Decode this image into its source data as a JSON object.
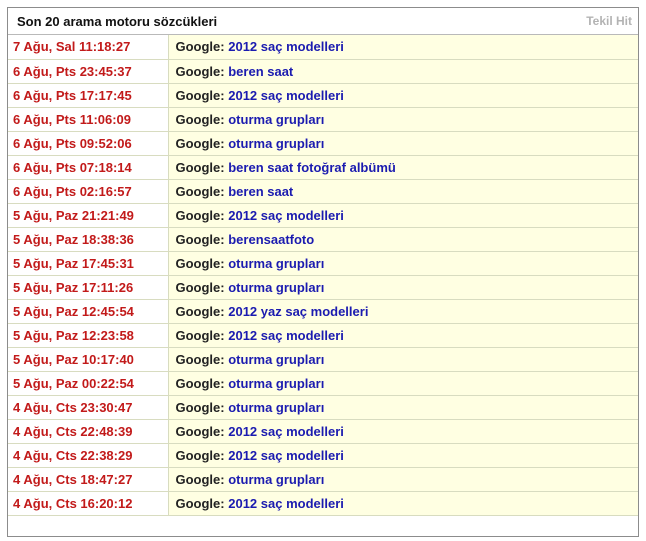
{
  "panel": {
    "title": "Son 20 arama motoru sözcükleri",
    "toggle_label": "Tekil Hit"
  },
  "colors": {
    "time_text": "#c21a1a",
    "keyword_text": "#1b1bb0",
    "row_background": "#ffffe2",
    "header_link": "#b3b3b3"
  },
  "rows": [
    {
      "time": "7 Ağu, Sal 11:18:27",
      "engine": "Google:",
      "keyword": "2012 saç modelleri"
    },
    {
      "time": "6 Ağu, Pts 23:45:37",
      "engine": "Google:",
      "keyword": "beren saat"
    },
    {
      "time": "6 Ağu, Pts 17:17:45",
      "engine": "Google:",
      "keyword": "2012 saç modelleri"
    },
    {
      "time": "6 Ağu, Pts 11:06:09",
      "engine": "Google:",
      "keyword": "oturma grupları"
    },
    {
      "time": "6 Ağu, Pts 09:52:06",
      "engine": "Google:",
      "keyword": "oturma grupları"
    },
    {
      "time": "6 Ağu, Pts 07:18:14",
      "engine": "Google:",
      "keyword": "beren saat fotoğraf albümü"
    },
    {
      "time": "6 Ağu, Pts 02:16:57",
      "engine": "Google:",
      "keyword": "beren saat"
    },
    {
      "time": "5 Ağu, Paz 21:21:49",
      "engine": "Google:",
      "keyword": "2012 saç modelleri"
    },
    {
      "time": "5 Ağu, Paz 18:38:36",
      "engine": "Google:",
      "keyword": "berensaatfoto"
    },
    {
      "time": "5 Ağu, Paz 17:45:31",
      "engine": "Google:",
      "keyword": "oturma grupları"
    },
    {
      "time": "5 Ağu, Paz 17:11:26",
      "engine": "Google:",
      "keyword": "oturma grupları"
    },
    {
      "time": "5 Ağu, Paz 12:45:54",
      "engine": "Google:",
      "keyword": "2012 yaz saç modelleri"
    },
    {
      "time": "5 Ağu, Paz 12:23:58",
      "engine": "Google:",
      "keyword": "2012 saç modelleri"
    },
    {
      "time": "5 Ağu, Paz 10:17:40",
      "engine": "Google:",
      "keyword": "oturma grupları"
    },
    {
      "time": "5 Ağu, Paz 00:22:54",
      "engine": "Google:",
      "keyword": "oturma grupları"
    },
    {
      "time": "4 Ağu, Cts 23:30:47",
      "engine": "Google:",
      "keyword": "oturma grupları"
    },
    {
      "time": "4 Ağu, Cts 22:48:39",
      "engine": "Google:",
      "keyword": "2012 saç modelleri"
    },
    {
      "time": "4 Ağu, Cts 22:38:29",
      "engine": "Google:",
      "keyword": "2012 saç modelleri"
    },
    {
      "time": "4 Ağu, Cts 18:47:27",
      "engine": "Google:",
      "keyword": "oturma grupları"
    },
    {
      "time": "4 Ağu, Cts 16:20:12",
      "engine": "Google:",
      "keyword": "2012 saç modelleri"
    }
  ]
}
